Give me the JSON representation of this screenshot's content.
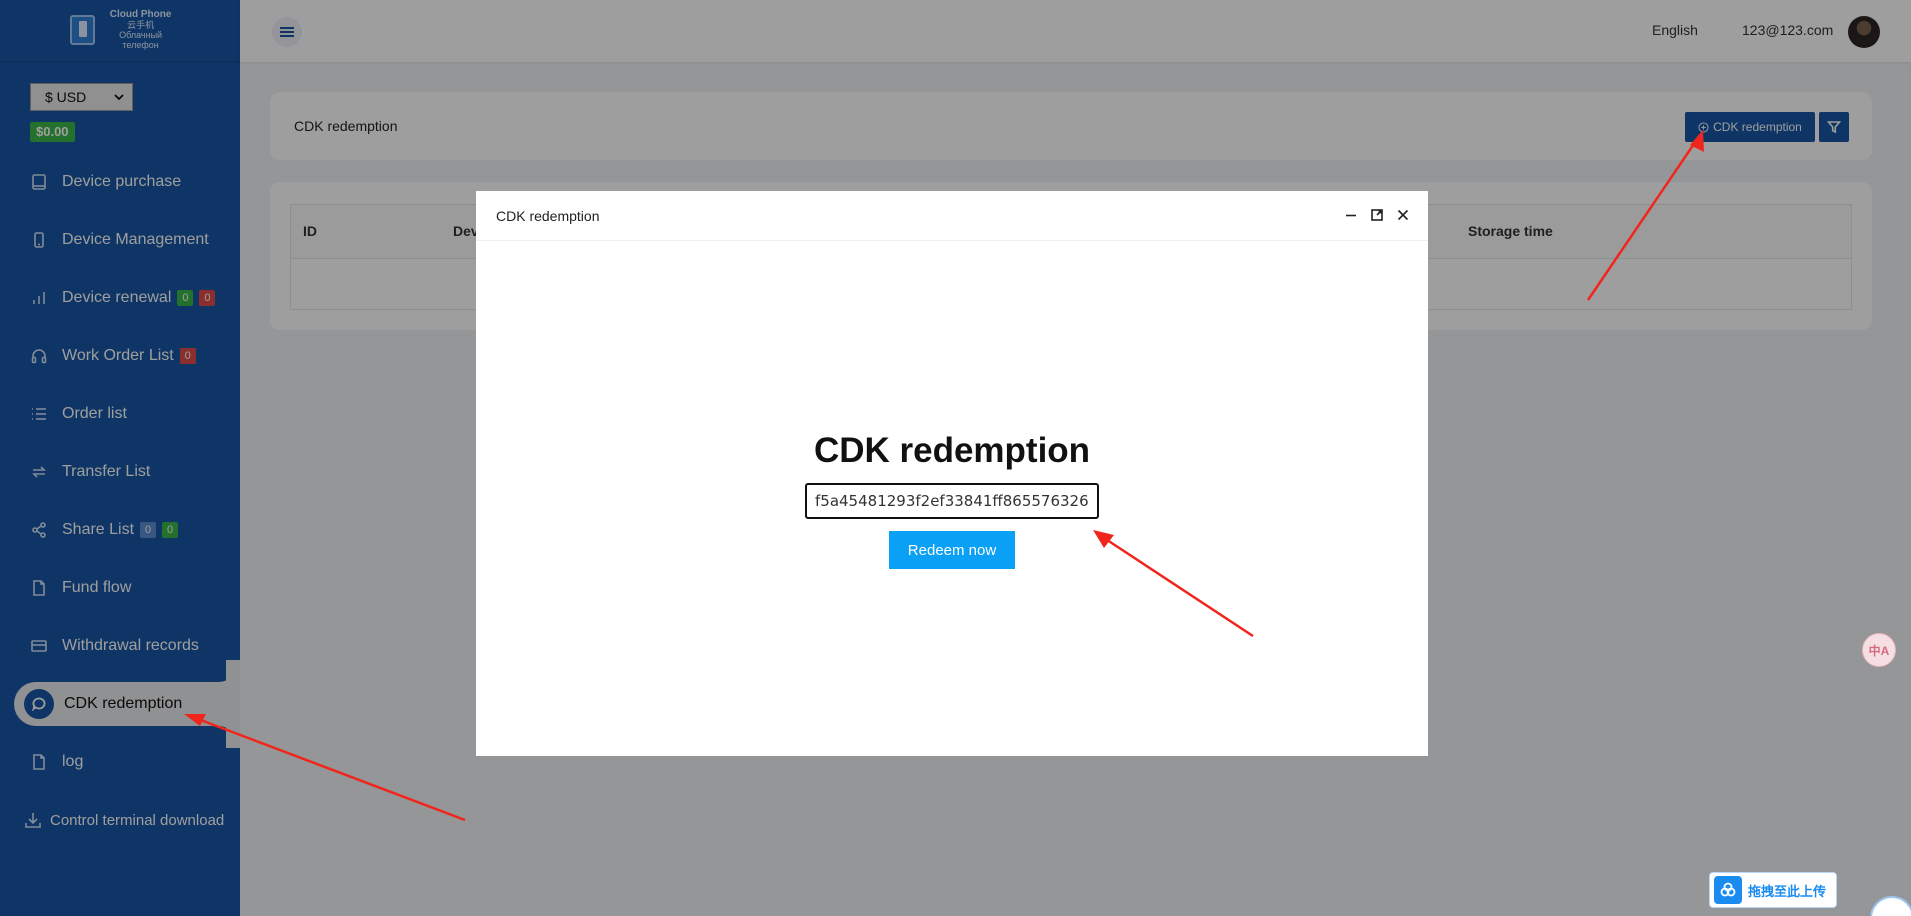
{
  "brand": {
    "line1": "Cloud Phone",
    "line2": "云手机",
    "line3": "Облачный телефон"
  },
  "currency": {
    "selected": "$ USD"
  },
  "balance": "$0.00",
  "nav": [
    {
      "label": "Device purchase",
      "icon": "tablet-icon"
    },
    {
      "label": "Device Management",
      "icon": "phone-icon"
    },
    {
      "label": "Device renewal",
      "icon": "bar-chart-icon",
      "badges": [
        "0",
        "0"
      ]
    },
    {
      "label": "Work Order List",
      "icon": "headset-icon",
      "badges": [
        "0"
      ]
    },
    {
      "label": "Order list",
      "icon": "list-icon"
    },
    {
      "label": "Transfer List",
      "icon": "transfer-icon"
    },
    {
      "label": "Share List",
      "icon": "share-icon",
      "badges": [
        "0",
        "0"
      ]
    },
    {
      "label": "Fund flow",
      "icon": "document-icon"
    },
    {
      "label": "Withdrawal records",
      "icon": "card-icon"
    },
    {
      "label": "CDK redemption",
      "icon": "chat-icon",
      "active": true
    },
    {
      "label": "log",
      "icon": "file-icon"
    },
    {
      "label": "Control terminal download",
      "icon": "download-icon"
    }
  ],
  "header": {
    "language": "English",
    "email": "123@123.com"
  },
  "page": {
    "title": "CDK redemption",
    "cdk_button": "CDK redemption"
  },
  "table": {
    "columns": [
      "ID",
      "Dev",
      "Storage time"
    ]
  },
  "modal": {
    "title": "CDK redemption",
    "heading": "CDK redemption",
    "input_value": "f5a45481293f2ef33841ff865576326",
    "redeem_button": "Redeem now"
  },
  "widgets": {
    "translate": "中A",
    "upload": "拖拽至此上传"
  },
  "colors": {
    "sidebar": "#1756a4",
    "accent": "#0aa0f5",
    "badge_green": "#3bb54a",
    "badge_red": "#e04b4b"
  }
}
